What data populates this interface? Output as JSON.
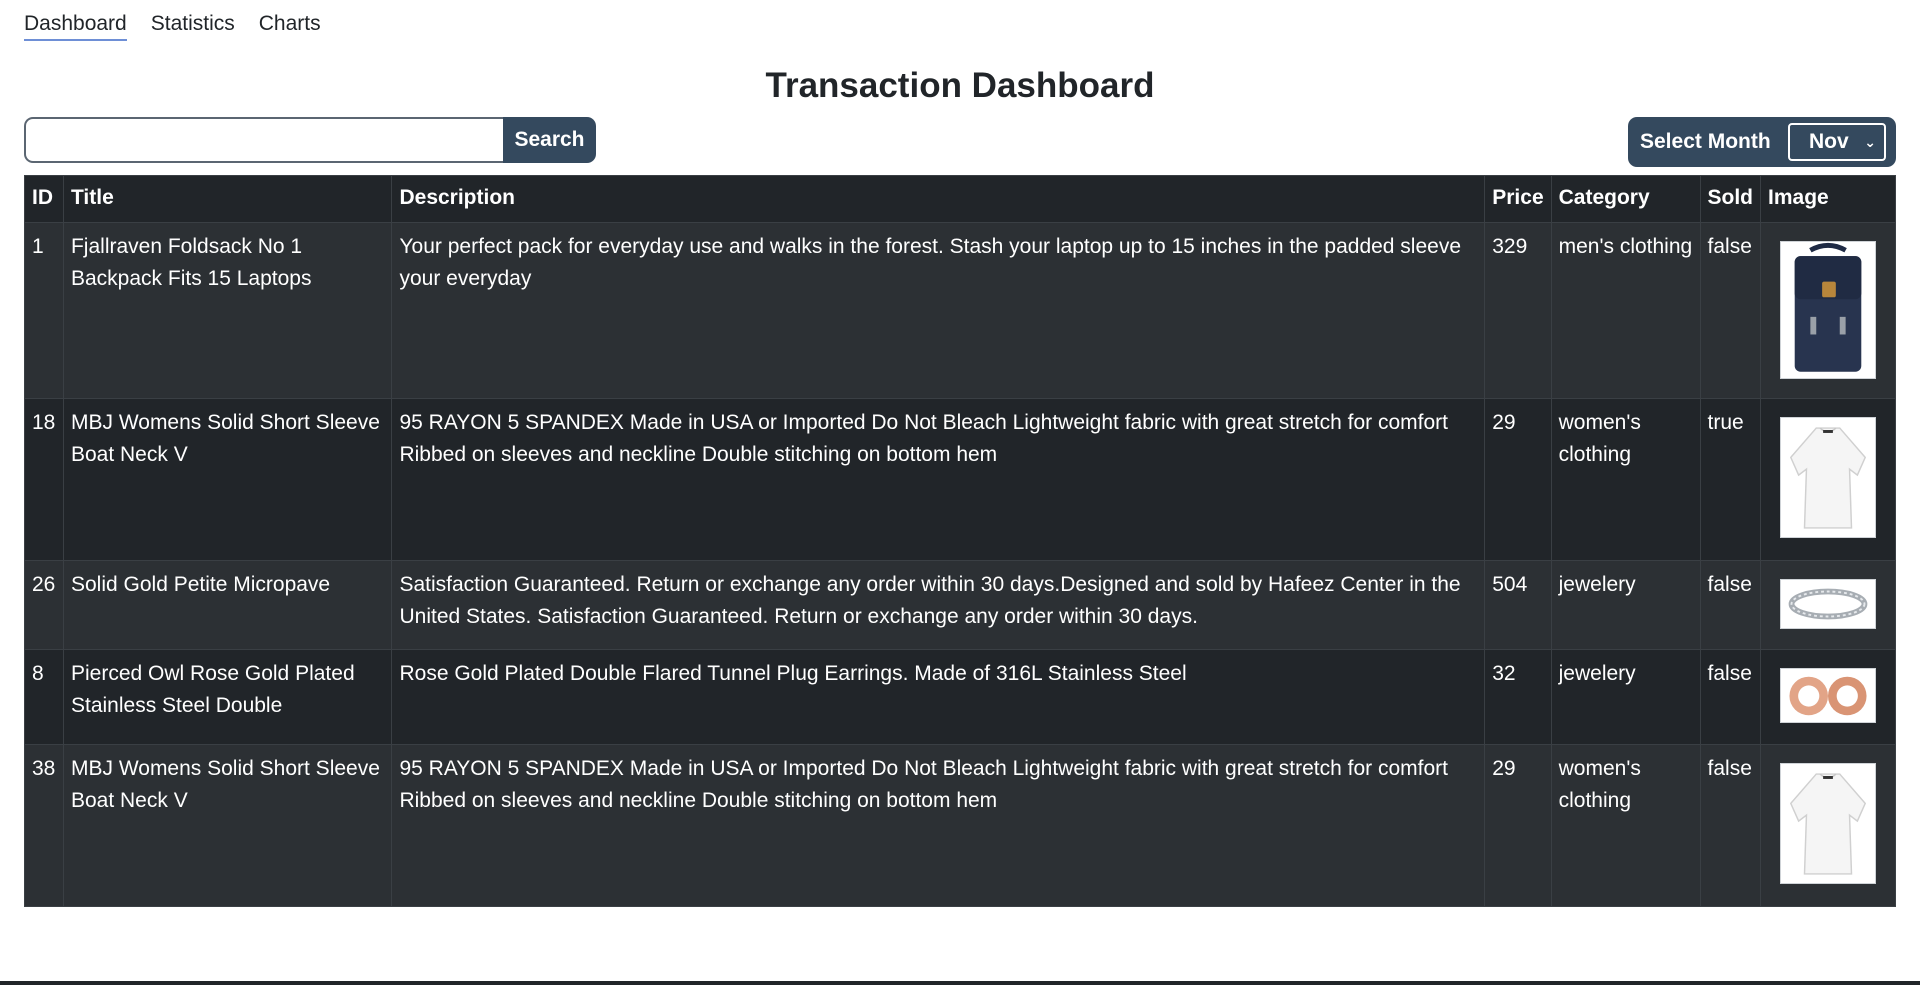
{
  "nav": {
    "items": [
      {
        "label": "Dashboard",
        "active": true
      },
      {
        "label": "Statistics",
        "active": false
      },
      {
        "label": "Charts",
        "active": false
      }
    ]
  },
  "page": {
    "title": "Transaction Dashboard"
  },
  "search": {
    "value": "",
    "placeholder": "",
    "button_label": "Search"
  },
  "month": {
    "label": "Select Month",
    "selected": "Nov"
  },
  "table": {
    "headers": {
      "id": "ID",
      "title": "Title",
      "description": "Description",
      "price": "Price",
      "category": "Category",
      "sold": "Sold",
      "image": "Image"
    },
    "rows": [
      {
        "id": "1",
        "title": "Fjallraven Foldsack No 1 Backpack Fits 15 Laptops",
        "description": "Your perfect pack for everyday use and walks in the forest. Stash your laptop up to 15 inches in the padded sleeve your everyday",
        "price": "329",
        "category": "men's clothing",
        "sold": "false",
        "image": "backpack"
      },
      {
        "id": "18",
        "title": "MBJ Womens Solid Short Sleeve Boat Neck V",
        "description": "95 RAYON 5 SPANDEX Made in USA or Imported Do Not Bleach Lightweight fabric with great stretch for comfort Ribbed on sleeves and neckline Double stitching on bottom hem",
        "price": "29",
        "category": "women's clothing",
        "sold": "true",
        "image": "white-top"
      },
      {
        "id": "26",
        "title": "Solid Gold Petite Micropave",
        "description": "Satisfaction Guaranteed. Return or exchange any order within 30 days.Designed and sold by Hafeez Center in the United States. Satisfaction Guaranteed. Return or exchange any order within 30 days.",
        "price": "504",
        "category": "jewelery",
        "sold": "false",
        "image": "ring"
      },
      {
        "id": "8",
        "title": "Pierced Owl Rose Gold Plated Stainless Steel Double",
        "description": "Rose Gold Plated Double Flared Tunnel Plug Earrings. Made of 316L Stainless Steel",
        "price": "32",
        "category": "jewelery",
        "sold": "false",
        "image": "earrings"
      },
      {
        "id": "38",
        "title": "MBJ Womens Solid Short Sleeve Boat Neck V",
        "description": "95 RAYON 5 SPANDEX Made in USA or Imported Do Not Bleach Lightweight fabric with great stretch for comfort Ribbed on sleeves and neckline Double stitching on bottom hem",
        "price": "29",
        "category": "women's clothing",
        "sold": "false",
        "image": "white-top"
      }
    ]
  },
  "colors": {
    "table_bg": "#212529",
    "table_stripe": "#2c3034",
    "button_bg": "#34495e",
    "active_underline": "#6e8fd6"
  }
}
